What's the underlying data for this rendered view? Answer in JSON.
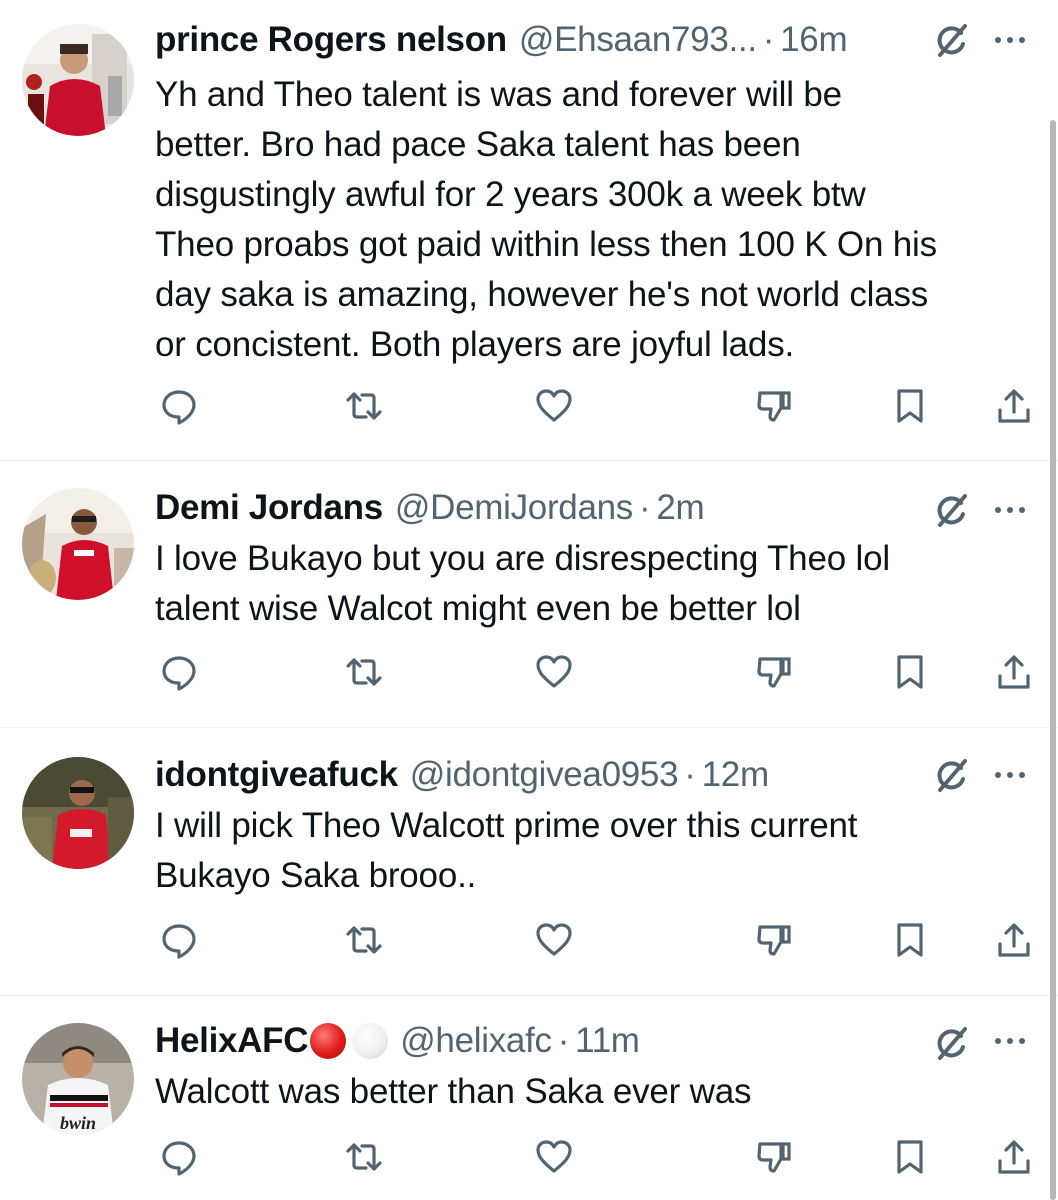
{
  "colors": {
    "text": "#0f1419",
    "secondary": "#536471",
    "divider": "#eff3f4",
    "background": "#ffffff"
  },
  "icons": {
    "actions": [
      "reply-icon",
      "repost-icon",
      "like-icon",
      "dislike-icon",
      "bookmark-icon",
      "share-icon"
    ],
    "header": [
      "grok-icon",
      "more-icon"
    ]
  },
  "tweets": [
    {
      "name": "prince Rogers nelson",
      "handle": "@Ehsaan793...",
      "separator": "·",
      "time": "16m",
      "lines": [
        "Yh and Theo talent is was and forever will be",
        "better. Bro had pace Saka talent has been",
        "disgustingly awful for 2 years 300k a week btw",
        "Theo proabs got paid within less then 100 K On his",
        "day saka is amazing, however he's not world class",
        "or concistent. Both players are joyful lads."
      ]
    },
    {
      "name": "Demi Jordans",
      "handle": "@DemiJordans",
      "separator": "·",
      "time": "2m",
      "lines": [
        "I love Bukayo but you are disrespecting Theo lol",
        "talent wise Walcot might even be better lol"
      ]
    },
    {
      "name": "idontgiveafuck",
      "handle": "@idontgivea0953",
      "separator": "·",
      "time": "12m",
      "lines": [
        "I will pick Theo Walcott prime over this current",
        "Bukayo Saka brooo.."
      ]
    },
    {
      "name": "HelixAFC",
      "handle": "@helixafc",
      "separator": "·",
      "time": "11m",
      "badges": [
        "red-circle",
        "white-circle"
      ],
      "lines": [
        "Walcott was better than Saka ever was"
      ],
      "avatar_text": "bwin"
    }
  ]
}
